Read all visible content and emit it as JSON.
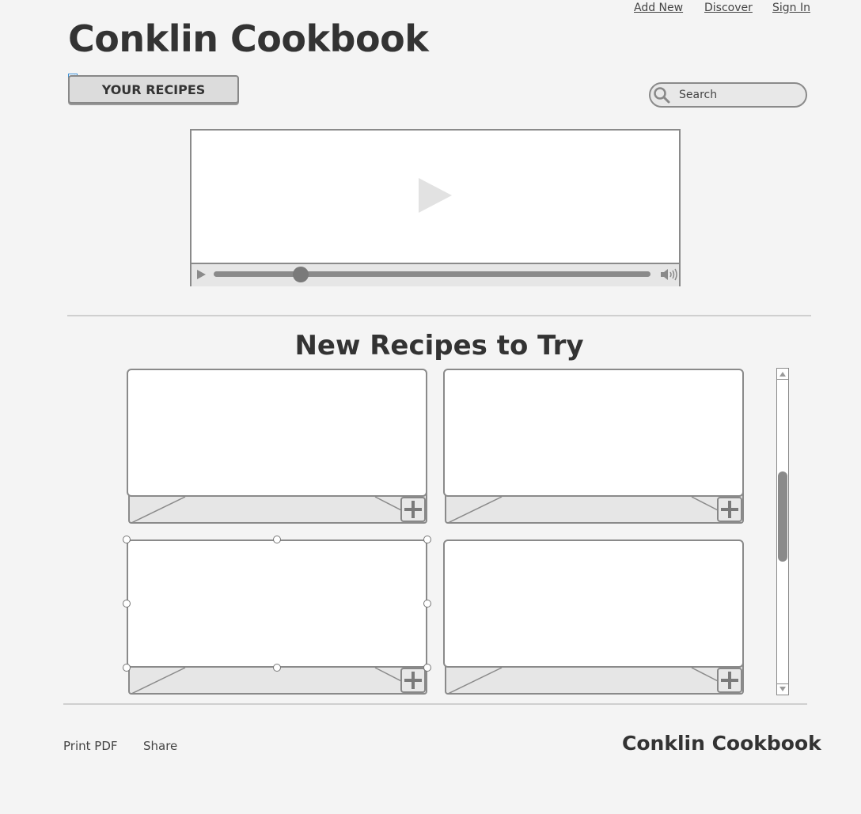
{
  "nav": {
    "add_new": "Add New",
    "discover": "Discover",
    "sign_in": "Sign In"
  },
  "header": {
    "title": "Conklin Cookbook",
    "your_recipes_label": "YOUR RECIPES"
  },
  "search": {
    "placeholder": "Search"
  },
  "video": {
    "progress_fraction": 0.2
  },
  "section": {
    "heading": "New Recipes to Try"
  },
  "footer": {
    "print_pdf": "Print PDF",
    "share": "Share",
    "brand": "Conklin Cookbook"
  },
  "colors": {
    "background": "#f4f4f4",
    "border": "#8a8a8a",
    "text": "#333333"
  }
}
